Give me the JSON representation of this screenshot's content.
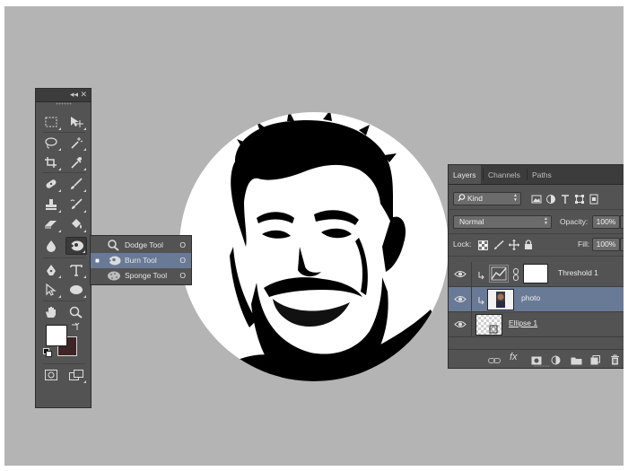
{
  "tools_panel": {
    "collapse_glyph": "◂◂",
    "close_glyph": "✕",
    "active_tool": "burn-tool",
    "colors": {
      "foreground": "#ffffff",
      "background": "#3e2426"
    }
  },
  "flyout": {
    "items": [
      {
        "label": "Dodge Tool",
        "key": "O",
        "icon": "dodge-icon",
        "selected": false
      },
      {
        "label": "Burn Tool",
        "key": "O",
        "icon": "burn-icon",
        "selected": true,
        "mark": "■"
      },
      {
        "label": "Sponge Tool",
        "key": "O",
        "icon": "sponge-icon",
        "selected": false
      }
    ]
  },
  "layers_panel": {
    "tabs": [
      "Layers",
      "Channels",
      "Paths"
    ],
    "active_tab": "Layers",
    "kind_filter": "Kind",
    "blend_mode": "Normal",
    "opacity_label": "Opacity:",
    "opacity_value": "100%",
    "lock_label": "Lock:",
    "fill_label": "Fill:",
    "fill_value": "100%",
    "layers": [
      {
        "name": "Threshold 1",
        "type": "adjustment",
        "visible": true,
        "clipped": true,
        "selected": false
      },
      {
        "name": "photo",
        "type": "image",
        "visible": true,
        "clipped": true,
        "selected": true
      },
      {
        "name": "Ellipse 1",
        "type": "shape",
        "visible": true,
        "clipped": false,
        "selected": false,
        "underlined": true
      }
    ],
    "footer_label_fx": "fx"
  },
  "colors": {
    "canvas_bg": "#b4b4b4",
    "panel_bg": "#535353",
    "selection": "#697a96"
  }
}
